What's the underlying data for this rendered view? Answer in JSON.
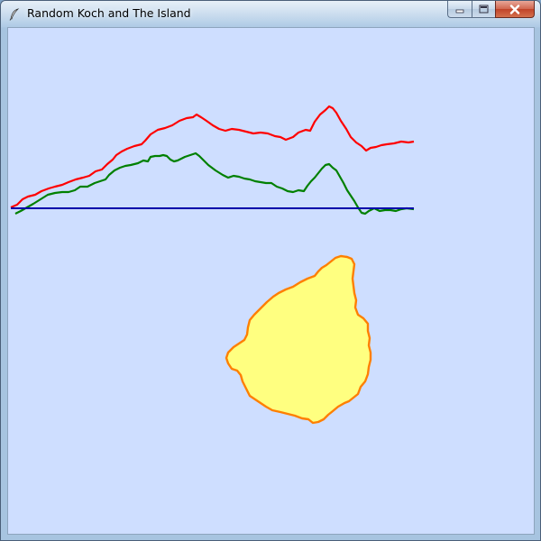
{
  "window": {
    "title": "Random Koch and The Island",
    "icon": "feather-icon",
    "controls": {
      "minimize": "minimize-icon",
      "maximize": "maximize-icon",
      "close": "close-icon"
    }
  },
  "canvas": {
    "background": "#cedeff",
    "curves": [
      {
        "color": "#ff0000",
        "kind": "random-koch-curve"
      },
      {
        "color": "#008000",
        "kind": "random-koch-curve"
      },
      {
        "color": "#0000aa",
        "kind": "baseline"
      }
    ],
    "island": {
      "fill": "#ffff80",
      "stroke": "#ff7f00"
    }
  }
}
